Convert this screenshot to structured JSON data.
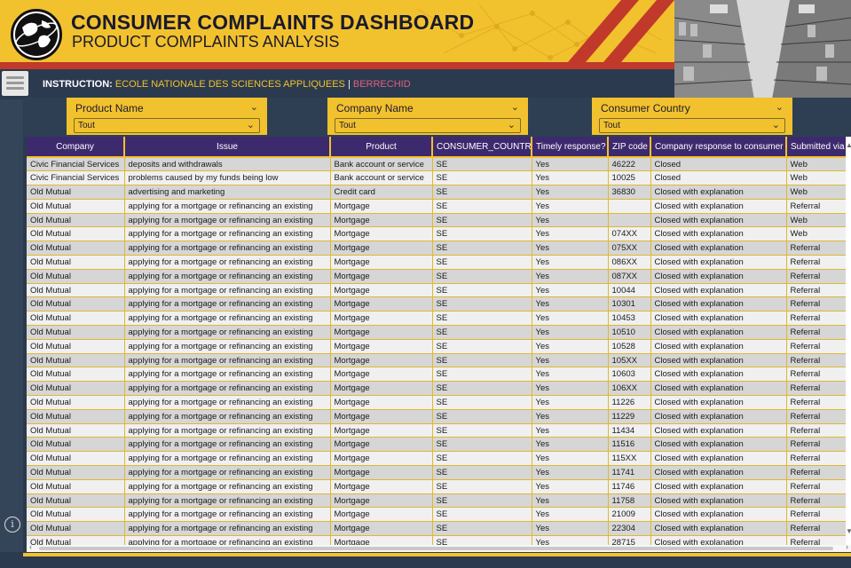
{
  "header": {
    "title": "CONSUMER COMPLAINTS DASHBOARD",
    "subtitle": "PRODUCT COMPLAINTS ANALYSIS"
  },
  "instruction": {
    "label": "INSTRUCTION:",
    "value1": "ECOLE NATIONALE DES SCIENCES APPLIQUEES",
    "separator": "|",
    "value2": "BERRECHID"
  },
  "filters": [
    {
      "label": "Product Name",
      "value": "Tout"
    },
    {
      "label": "Company Name",
      "value": "Tout"
    },
    {
      "label": "Consumer Country",
      "value": "Tout"
    }
  ],
  "table": {
    "columns": [
      "Company",
      "Issue",
      "Product",
      "CONSUMER_COUNTRY",
      "Timely response?",
      "ZIP code",
      "Company response to consumer",
      "Submitted via"
    ],
    "rows": [
      [
        "Civic Financial Services",
        "deposits and withdrawals",
        "Bank account or service",
        "SE",
        "Yes",
        "46222",
        "Closed",
        "Web"
      ],
      [
        "Civic Financial Services",
        "problems caused by my funds being low",
        "Bank account or service",
        "SE",
        "Yes",
        "10025",
        "Closed",
        "Web"
      ],
      [
        "Old Mutual",
        "advertising and marketing",
        "Credit card",
        "SE",
        "Yes",
        "36830",
        "Closed with explanation",
        "Web"
      ],
      [
        "Old Mutual",
        "applying for a mortgage or refinancing an existing",
        "Mortgage",
        "SE",
        "Yes",
        "",
        "Closed with explanation",
        "Referral"
      ],
      [
        "Old Mutual",
        "applying for a mortgage or refinancing an existing",
        "Mortgage",
        "SE",
        "Yes",
        "",
        "Closed with explanation",
        "Web"
      ],
      [
        "Old Mutual",
        "applying for a mortgage or refinancing an existing",
        "Mortgage",
        "SE",
        "Yes",
        "074XX",
        "Closed with explanation",
        "Web"
      ],
      [
        "Old Mutual",
        "applying for a mortgage or refinancing an existing",
        "Mortgage",
        "SE",
        "Yes",
        "075XX",
        "Closed with explanation",
        "Referral"
      ],
      [
        "Old Mutual",
        "applying for a mortgage or refinancing an existing",
        "Mortgage",
        "SE",
        "Yes",
        "086XX",
        "Closed with explanation",
        "Referral"
      ],
      [
        "Old Mutual",
        "applying for a mortgage or refinancing an existing",
        "Mortgage",
        "SE",
        "Yes",
        "087XX",
        "Closed with explanation",
        "Referral"
      ],
      [
        "Old Mutual",
        "applying for a mortgage or refinancing an existing",
        "Mortgage",
        "SE",
        "Yes",
        "10044",
        "Closed with explanation",
        "Referral"
      ],
      [
        "Old Mutual",
        "applying for a mortgage or refinancing an existing",
        "Mortgage",
        "SE",
        "Yes",
        "10301",
        "Closed with explanation",
        "Referral"
      ],
      [
        "Old Mutual",
        "applying for a mortgage or refinancing an existing",
        "Mortgage",
        "SE",
        "Yes",
        "10453",
        "Closed with explanation",
        "Referral"
      ],
      [
        "Old Mutual",
        "applying for a mortgage or refinancing an existing",
        "Mortgage",
        "SE",
        "Yes",
        "10510",
        "Closed with explanation",
        "Referral"
      ],
      [
        "Old Mutual",
        "applying for a mortgage or refinancing an existing",
        "Mortgage",
        "SE",
        "Yes",
        "10528",
        "Closed with explanation",
        "Referral"
      ],
      [
        "Old Mutual",
        "applying for a mortgage or refinancing an existing",
        "Mortgage",
        "SE",
        "Yes",
        "105XX",
        "Closed with explanation",
        "Referral"
      ],
      [
        "Old Mutual",
        "applying for a mortgage or refinancing an existing",
        "Mortgage",
        "SE",
        "Yes",
        "10603",
        "Closed with explanation",
        "Referral"
      ],
      [
        "Old Mutual",
        "applying for a mortgage or refinancing an existing",
        "Mortgage",
        "SE",
        "Yes",
        "106XX",
        "Closed with explanation",
        "Referral"
      ],
      [
        "Old Mutual",
        "applying for a mortgage or refinancing an existing",
        "Mortgage",
        "SE",
        "Yes",
        "11226",
        "Closed with explanation",
        "Referral"
      ],
      [
        "Old Mutual",
        "applying for a mortgage or refinancing an existing",
        "Mortgage",
        "SE",
        "Yes",
        "11229",
        "Closed with explanation",
        "Referral"
      ],
      [
        "Old Mutual",
        "applying for a mortgage or refinancing an existing",
        "Mortgage",
        "SE",
        "Yes",
        "11434",
        "Closed with explanation",
        "Referral"
      ],
      [
        "Old Mutual",
        "applying for a mortgage or refinancing an existing",
        "Mortgage",
        "SE",
        "Yes",
        "11516",
        "Closed with explanation",
        "Referral"
      ],
      [
        "Old Mutual",
        "applying for a mortgage or refinancing an existing",
        "Mortgage",
        "SE",
        "Yes",
        "115XX",
        "Closed with explanation",
        "Referral"
      ],
      [
        "Old Mutual",
        "applying for a mortgage or refinancing an existing",
        "Mortgage",
        "SE",
        "Yes",
        "11741",
        "Closed with explanation",
        "Referral"
      ],
      [
        "Old Mutual",
        "applying for a mortgage or refinancing an existing",
        "Mortgage",
        "SE",
        "Yes",
        "11746",
        "Closed with explanation",
        "Referral"
      ],
      [
        "Old Mutual",
        "applying for a mortgage or refinancing an existing",
        "Mortgage",
        "SE",
        "Yes",
        "11758",
        "Closed with explanation",
        "Referral"
      ],
      [
        "Old Mutual",
        "applying for a mortgage or refinancing an existing",
        "Mortgage",
        "SE",
        "Yes",
        "21009",
        "Closed with explanation",
        "Referral"
      ],
      [
        "Old Mutual",
        "applying for a mortgage or refinancing an existing",
        "Mortgage",
        "SE",
        "Yes",
        "22304",
        "Closed with explanation",
        "Referral"
      ],
      [
        "Old Mutual",
        "applying for a mortgage or refinancing an existing",
        "Mortgage",
        "SE",
        "Yes",
        "28715",
        "Closed with explanation",
        "Referral"
      ]
    ]
  },
  "colors": {
    "accent_yellow": "#f2c12e",
    "header_purple": "#3d2a6e",
    "background_navy": "#2b3a4e",
    "header_red": "#c0392b",
    "instruction_pink": "#e06080"
  },
  "icons": {
    "logo": "globe-logo-icon",
    "menu": "hamburger-menu-icon",
    "info": "info-icon",
    "dropdown": "chevron-down-icon"
  }
}
